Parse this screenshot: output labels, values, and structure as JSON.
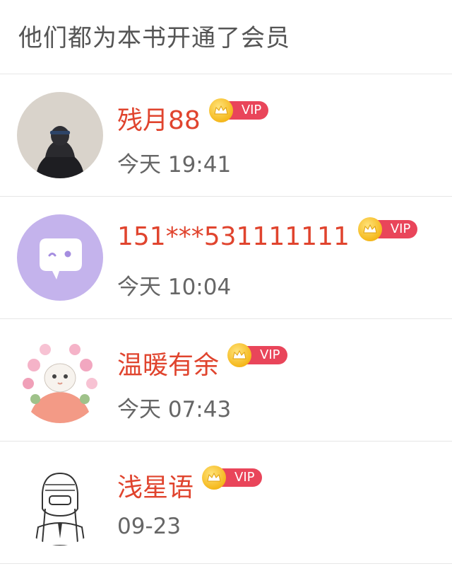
{
  "header": {
    "title": "他们都为本书开通了会员"
  },
  "members": [
    {
      "name": "残月88",
      "vip": "VIP",
      "time": "今天 19:41",
      "avatar": "dark-figure-avatar"
    },
    {
      "name": "151***531111111",
      "vip": "VIP",
      "time": "今天 10:04",
      "avatar": "chat-bubble-avatar"
    },
    {
      "name": "温暖有余",
      "vip": "VIP",
      "time": "今天 07:43",
      "avatar": "cat-flower-avatar"
    },
    {
      "name": "浅星语",
      "vip": "VIP",
      "time": "09-23",
      "avatar": "sketch-girl-avatar"
    }
  ],
  "colors": {
    "name": "#e0442e",
    "vip_pill": "#e9455a",
    "crown": "#f5b81c",
    "divider": "#e6e6e6"
  }
}
